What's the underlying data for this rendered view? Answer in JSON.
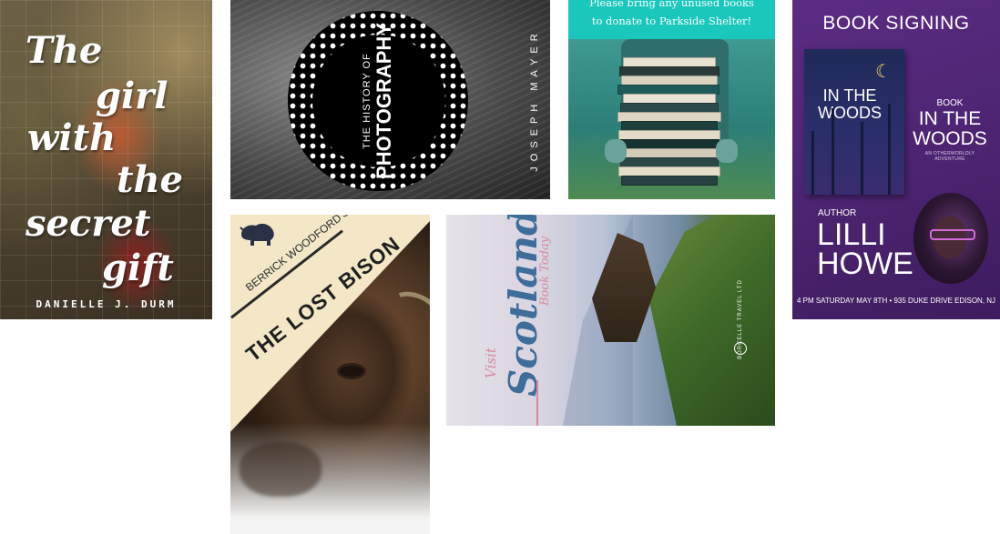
{
  "cards": {
    "girl": {
      "title_lines": [
        "The",
        "girl",
        "with",
        "the",
        "secret",
        "gift"
      ],
      "author": "DANIELLE J. DURM"
    },
    "photography": {
      "title_small": "THE HISTORY OF",
      "title_big": "PHOTOGRAPHY",
      "author": "JOSEPH MAYER"
    },
    "donate": {
      "message_line1": "Please bring any unused books",
      "message_line2": "to donate to Parkside Shelter!"
    },
    "signing": {
      "heading": "BOOK SIGNING",
      "cover_title": "IN THE WOODS",
      "book_label": "BOOK",
      "book_title": "IN THE WOODS",
      "tagline": "AN OTHERWORLDLY ADVENTURE",
      "author_label": "AUTHOR",
      "author_name_1": "LILLI",
      "author_name_2": "HOWE",
      "footer": "4 PM SATURDAY MAY 8TH  •  935 DUKE DRIVE EDISON, NJ"
    },
    "bison": {
      "subtitle": "BERRICK WOODFORD'S",
      "title": "THE LOST BISON"
    },
    "scotland": {
      "visit": "Visit",
      "title": "Scotland",
      "cta": "Book Today",
      "brand": "BORCELLE TRAVEL LTD"
    }
  }
}
